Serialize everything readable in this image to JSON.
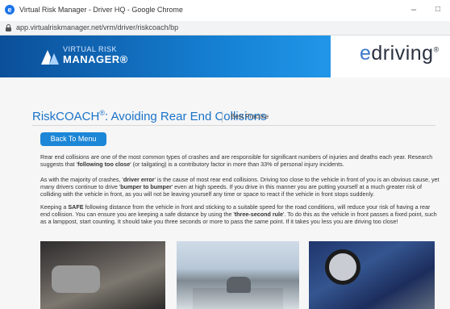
{
  "browser": {
    "title": "Virtual Risk Manager - Driver HQ - Google Chrome",
    "url": "app.virtualriskmanager.net/vrm/driver/riskcoach/bp",
    "minimize": "–",
    "maximize": "□"
  },
  "header": {
    "logo_line1": "VIRTUAL RISK",
    "logo_line2": "MANAGER®",
    "brand_e": "e",
    "brand_rest": "driving",
    "brand_mark": "®",
    "accent": "#1683d6"
  },
  "page": {
    "title": "RiskCOACH",
    "title_reg": "®",
    "title_rest": ": Avoiding Rear End Collisions",
    "tag": "Best Practice",
    "back_button": "Back To Menu"
  },
  "paragraphs": {
    "p1a": "Rear end collisions are one of the most common types of crashes and are responsible for significant numbers of injuries and deaths each year. Research suggests that '",
    "p1b": "following too close",
    "p1c": "' (or tailgating) is a contributory factor in more than 33% of personal injury incidents.",
    "p2a": "As with the majority of crashes, '",
    "p2b": "driver error",
    "p2c": "' is the cause of most rear end collisions. Driving too close to the vehicle in front of you is an obvious cause, yet many drivers continue to drive '",
    "p2d": "bumper to bumper",
    "p2e": "' even at high speeds. If you drive in this manner you are putting yourself at a much greater risk of colliding with the vehicle in front, as you will not be leaving yourself any time or space to react if the vehicle in front stops suddenly.",
    "p3a": "Keeping a ",
    "p3b": "SAFE",
    "p3c": " following distance from the vehicle in front and sticking to a suitable speed for the road conditions, will reduce your risk of having a rear end collision. You can ensure you are keeping a safe distance by using the '",
    "p3d": "three-second rule",
    "p3e": "'. To do this as the vehicle in front passes a fixed point, such as a lamppost, start counting. It should take you three seconds or more to pass the same point. If it takes you less you are driving too close!"
  }
}
